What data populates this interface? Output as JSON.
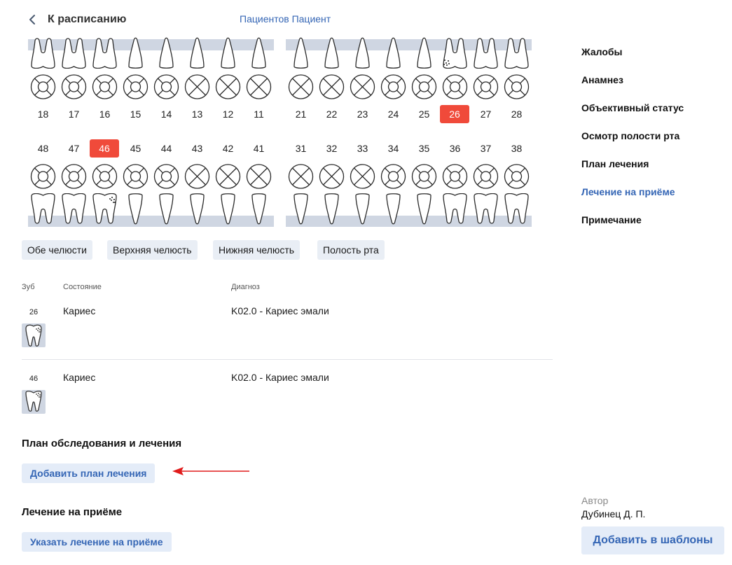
{
  "header": {
    "back_label": "К расписанию",
    "patient_name": "Пациентов Пациент"
  },
  "dental_chart": {
    "upper_left": [
      {
        "num": "18",
        "shape": "molar",
        "state": "normal"
      },
      {
        "num": "17",
        "shape": "molar",
        "state": "normal"
      },
      {
        "num": "16",
        "shape": "molar",
        "state": "normal"
      },
      {
        "num": "15",
        "shape": "single",
        "state": "normal"
      },
      {
        "num": "14",
        "shape": "single",
        "state": "normal"
      },
      {
        "num": "13",
        "shape": "single",
        "state": "missing"
      },
      {
        "num": "12",
        "shape": "single",
        "state": "missing"
      },
      {
        "num": "11",
        "shape": "single",
        "state": "missing"
      }
    ],
    "upper_right": [
      {
        "num": "21",
        "shape": "single",
        "state": "missing"
      },
      {
        "num": "22",
        "shape": "single",
        "state": "missing"
      },
      {
        "num": "23",
        "shape": "single",
        "state": "missing"
      },
      {
        "num": "24",
        "shape": "single",
        "state": "normal"
      },
      {
        "num": "25",
        "shape": "single",
        "state": "normal"
      },
      {
        "num": "26",
        "shape": "molar",
        "state": "caries",
        "selected": true
      },
      {
        "num": "27",
        "shape": "molar",
        "state": "normal"
      },
      {
        "num": "28",
        "shape": "molar",
        "state": "normal"
      }
    ],
    "lower_left": [
      {
        "num": "48",
        "shape": "molar",
        "state": "normal"
      },
      {
        "num": "47",
        "shape": "molar",
        "state": "normal"
      },
      {
        "num": "46",
        "shape": "molar",
        "state": "caries",
        "selected": true
      },
      {
        "num": "45",
        "shape": "single",
        "state": "normal"
      },
      {
        "num": "44",
        "shape": "single",
        "state": "normal"
      },
      {
        "num": "43",
        "shape": "single",
        "state": "missing"
      },
      {
        "num": "42",
        "shape": "single",
        "state": "missing"
      },
      {
        "num": "41",
        "shape": "single",
        "state": "missing"
      }
    ],
    "lower_right": [
      {
        "num": "31",
        "shape": "single",
        "state": "missing"
      },
      {
        "num": "32",
        "shape": "single",
        "state": "missing"
      },
      {
        "num": "33",
        "shape": "single",
        "state": "missing"
      },
      {
        "num": "34",
        "shape": "single",
        "state": "normal"
      },
      {
        "num": "35",
        "shape": "single",
        "state": "normal"
      },
      {
        "num": "36",
        "shape": "molar",
        "state": "normal"
      },
      {
        "num": "37",
        "shape": "molar",
        "state": "normal"
      },
      {
        "num": "38",
        "shape": "molar",
        "state": "normal"
      }
    ],
    "selected_color": "#f04a3a",
    "band_color": "#cfd6e2"
  },
  "jaw_buttons": [
    "Обе челюсти",
    "Верхняя челюсть",
    "Нижняя челюсть",
    "Полость рта"
  ],
  "diagnosis_table": {
    "headers": {
      "tooth": "Зуб",
      "condition": "Состояние",
      "diagnosis": "Диагноз"
    },
    "rows": [
      {
        "tooth": "26",
        "condition": "Кариес",
        "diagnosis": "K02.0 - Кариес эмали"
      },
      {
        "tooth": "46",
        "condition": "Кариес",
        "diagnosis": "K02.0 - Кариес эмали"
      }
    ]
  },
  "plan_section": {
    "title": "План обследования и лечения",
    "add_button": "Добавить план лечения"
  },
  "treatment_section": {
    "title": "Лечение на приёме",
    "add_button": "Указать лечение на приёме"
  },
  "sidebar": {
    "items": [
      {
        "label": "Жалобы",
        "active": false
      },
      {
        "label": "Анамнез",
        "active": false
      },
      {
        "label": "Объективный статус",
        "active": false
      },
      {
        "label": "Осмотр полости рта",
        "active": false
      },
      {
        "label": "План лечения",
        "active": false
      },
      {
        "label": "Лечение на приёме",
        "active": true
      },
      {
        "label": "Примечание",
        "active": false
      }
    ],
    "accent_color": "#3566b5"
  },
  "author": {
    "label": "Автор",
    "name": "Дубинец Д. П."
  },
  "templates_button": "Добавить в шаблоны"
}
